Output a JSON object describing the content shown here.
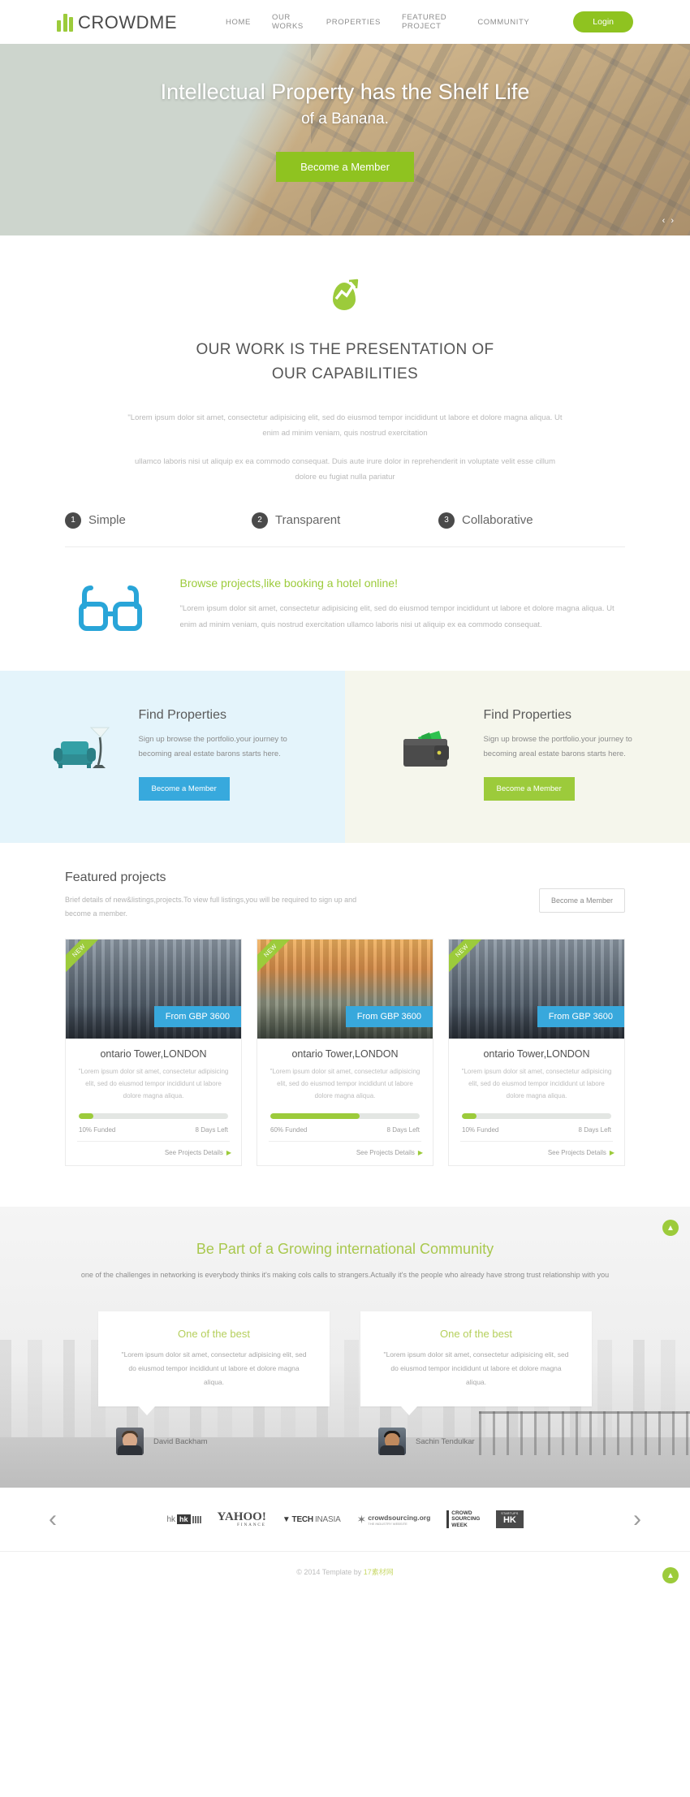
{
  "header": {
    "logo_text": "CROWDME",
    "nav": [
      {
        "label": "HOME"
      },
      {
        "label": "OUR WORKS"
      },
      {
        "label": "PROPERTIES"
      },
      {
        "label": "FEATURED PROJECT"
      },
      {
        "label": "COMMUNITY"
      }
    ],
    "login_label": "Login"
  },
  "hero": {
    "title_line1": "Intellectual Property has the Shelf Life",
    "title_line2": "of a Banana.",
    "cta_label": "Become a Member",
    "arrows": "‹ ›"
  },
  "work": {
    "heading_line1": "OUR WORK IS THE PRESENTATION OF",
    "heading_line2": "OUR CAPABILITIES",
    "paragraph1": "\"Lorem ipsum dolor sit amet, consectetur adipisicing elit, sed do eiusmod tempor incididunt ut labore et dolore magna aliqua. Ut enim ad minim veniam, quis nostrud exercitation",
    "paragraph2": "ullamco laboris nisi ut aliquip ex ea commodo consequat. Duis aute irure dolor in reprehenderit in voluptate velit esse cillum dolore eu fugiat nulla pariatur",
    "steps": [
      {
        "num": "1",
        "label": "Simple"
      },
      {
        "num": "2",
        "label": "Transparent"
      },
      {
        "num": "3",
        "label": "Collaborative"
      }
    ]
  },
  "browse": {
    "heading": "Browse projects,like booking a hotel online!",
    "body": "\"Lorem ipsum dolor sit amet, consectetur adipisicing elit, sed do eiusmod tempor incididunt ut labore et dolore magna aliqua. Ut enim ad minim veniam, quis nostrud exercitation ullamco laboris nisi ut aliquip ex ea commodo consequat."
  },
  "panels": [
    {
      "title": "Find Properties",
      "body": "Sign up browse the portfolio.your journey to becoming areal estate barons starts here.",
      "button_label": "Become a Member",
      "accent": "#37a9dd",
      "background": "#e4f4fb",
      "icon": "sofa-lamp-icon"
    },
    {
      "title": "Find Properties",
      "body": "Sign up browse the portfolio.your journey to becoming areal estate barons starts here.",
      "button_label": "Become a Member",
      "accent": "#9ccb3b",
      "background": "#f5f6ec",
      "icon": "wallet-icon"
    }
  ],
  "featured": {
    "title": "Featured projects",
    "subtitle": "Brief details of new&listings,projects.To view full listings,you will be required to sign up and become a member.",
    "button_label": "Become a Member",
    "cards": [
      {
        "ribbon": "NEW",
        "price": "From GBP 3600",
        "title": "ontario Tower,LONDON",
        "desc": "\"Lorem ipsum dolor sit amet, consectetur adipisicing elit, sed do eiusmod tempor incididunt ut labore dolore magna aliqua.",
        "funded": "10% Funded",
        "funded_pct": 10,
        "days_left": "8 Days Left",
        "details_label": "See Projects Details"
      },
      {
        "ribbon": "NEW",
        "price": "From GBP 3600",
        "title": "ontario Tower,LONDON",
        "desc": "\"Lorem ipsum dolor sit amet, consectetur adipisicing elit, sed do eiusmod tempor incididunt ut labore dolore magna aliqua.",
        "funded": "60% Funded",
        "funded_pct": 60,
        "days_left": "8 Days Left",
        "details_label": "See Projects Details"
      },
      {
        "ribbon": "NEW",
        "price": "From GBP 3600",
        "title": "ontario Tower,LONDON",
        "desc": "\"Lorem ipsum dolor sit amet, consectetur adipisicing elit, sed do eiusmod tempor incididunt ut labore dolore magna aliqua.",
        "funded": "10% Funded",
        "funded_pct": 10,
        "days_left": "8 Days Left",
        "details_label": "See Projects Details"
      }
    ]
  },
  "community": {
    "heading": "Be Part of a Growing international Community",
    "subtitle": "one of the challenges in networking is everybody thinks it's making cols calls to strangers.Actually it's the people who already have strong trust relationship with you",
    "testimonials": [
      {
        "heading": "One of the best",
        "quote": "\"Lorem ipsum dolor sit amet, consectetur adipisicing elit, sed do eiusmod tempor incididunt ut labore et dolore magna aliqua.",
        "author": "David Backham"
      },
      {
        "heading": "One of the best",
        "quote": "\"Lorem ipsum dolor sit amet, consectetur adipisicing elit, sed do eiusmod tempor incididunt ut labore et dolore magna aliqua.",
        "author": "Sachin Tendulkar"
      }
    ]
  },
  "clients": {
    "prev": "‹",
    "next": "›",
    "logos": [
      {
        "name": "hk-logo",
        "text": "hk"
      },
      {
        "name": "yahoo-finance-logo",
        "text": "YAHOO!",
        "sub": "FINANCE"
      },
      {
        "name": "tech-in-asia-logo",
        "text": "TECH",
        "sub": "INASIA"
      },
      {
        "name": "crowdsourcing-org-logo",
        "text": "crowdsourcing.org"
      },
      {
        "name": "crowd-sourcing-week-logo",
        "text": "CROWD SOURCING WEEK"
      },
      {
        "name": "hk-startups-logo",
        "text": "HK"
      }
    ]
  },
  "footer": {
    "copyright": "© 2014 Template by ",
    "brand": "17素材网"
  },
  "fabs": {
    "community_top": "▲",
    "scroll_top": "▲"
  }
}
